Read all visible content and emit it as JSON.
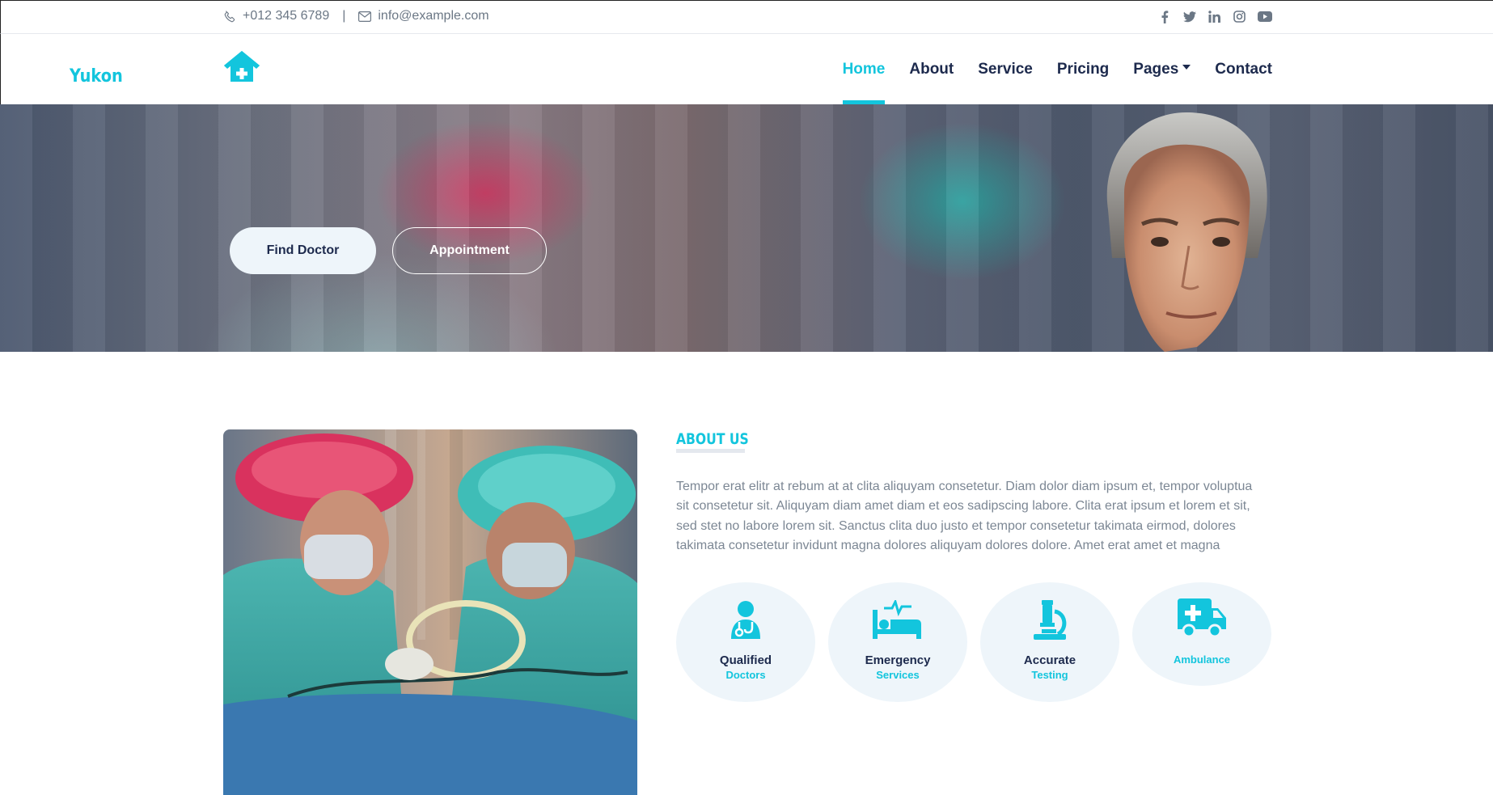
{
  "topbar": {
    "phone": "+012 345 6789",
    "separator": "|",
    "email": "info@example.com",
    "social": [
      "facebook-icon",
      "twitter-icon",
      "linkedin-icon",
      "instagram-icon",
      "youtube-icon"
    ]
  },
  "brand": {
    "name": "Yukon",
    "logo_icon": "hospital-house-icon"
  },
  "nav": {
    "items": [
      {
        "label": "Home",
        "active": true
      },
      {
        "label": "About"
      },
      {
        "label": "Service"
      },
      {
        "label": "Pricing"
      },
      {
        "label": "Pages",
        "dropdown": true
      },
      {
        "label": "Contact"
      }
    ]
  },
  "hero": {
    "find_doctor": "Find Doctor",
    "appointment": "Appointment"
  },
  "about": {
    "title": "ABOUT US",
    "text": "Tempor erat elitr at rebum at at clita aliquyam consetetur. Diam dolor diam ipsum et, tempor voluptua sit consetetur sit. Aliquyam diam amet diam et eos sadipscing labore. Clita erat ipsum et lorem et sit, sed stet no labore lorem sit. Sanctus clita duo justo et tempor consetetur takimata eirmod, dolores takimata consetetur invidunt magna dolores aliquyam dolores dolore. Amet erat amet et magna",
    "features": [
      {
        "title": "Qualified",
        "subtitle": "Doctors",
        "icon": "doctor-icon"
      },
      {
        "title": "Emergency",
        "subtitle": "Services",
        "icon": "procedures-bed-icon"
      },
      {
        "title": "Accurate",
        "subtitle": "Testing",
        "icon": "microscope-icon"
      },
      {
        "title": "",
        "subtitle": "Ambulance",
        "icon": "ambulance-icon"
      }
    ]
  },
  "colors": {
    "primary": "#13c5dd",
    "dark": "#1d2a4d",
    "light": "#eef5fa",
    "text": "#7c8794"
  }
}
